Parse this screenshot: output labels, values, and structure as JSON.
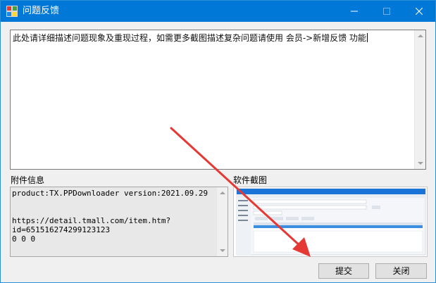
{
  "window": {
    "title": "问题反馈",
    "app_icon": "app-grid-icon"
  },
  "description": {
    "text": "此处请详细描述问题现象及重现过程，如需更多截图描述复杂问题请使用 会员->新增反馈 功能"
  },
  "attachment": {
    "label": "附件信息",
    "lines": [
      "product:TX.PPDownloader version:2021.09.29",
      "",
      "",
      "https://detail.tmall.com/item.htm?",
      "id=651516274299123123",
      "0 0 0"
    ]
  },
  "screenshot": {
    "label": "软件截图"
  },
  "buttons": {
    "submit": "提交",
    "cancel": "关闭"
  },
  "colors": {
    "titlebar": "#0078d7",
    "annotation_arrow": "#e53935"
  }
}
